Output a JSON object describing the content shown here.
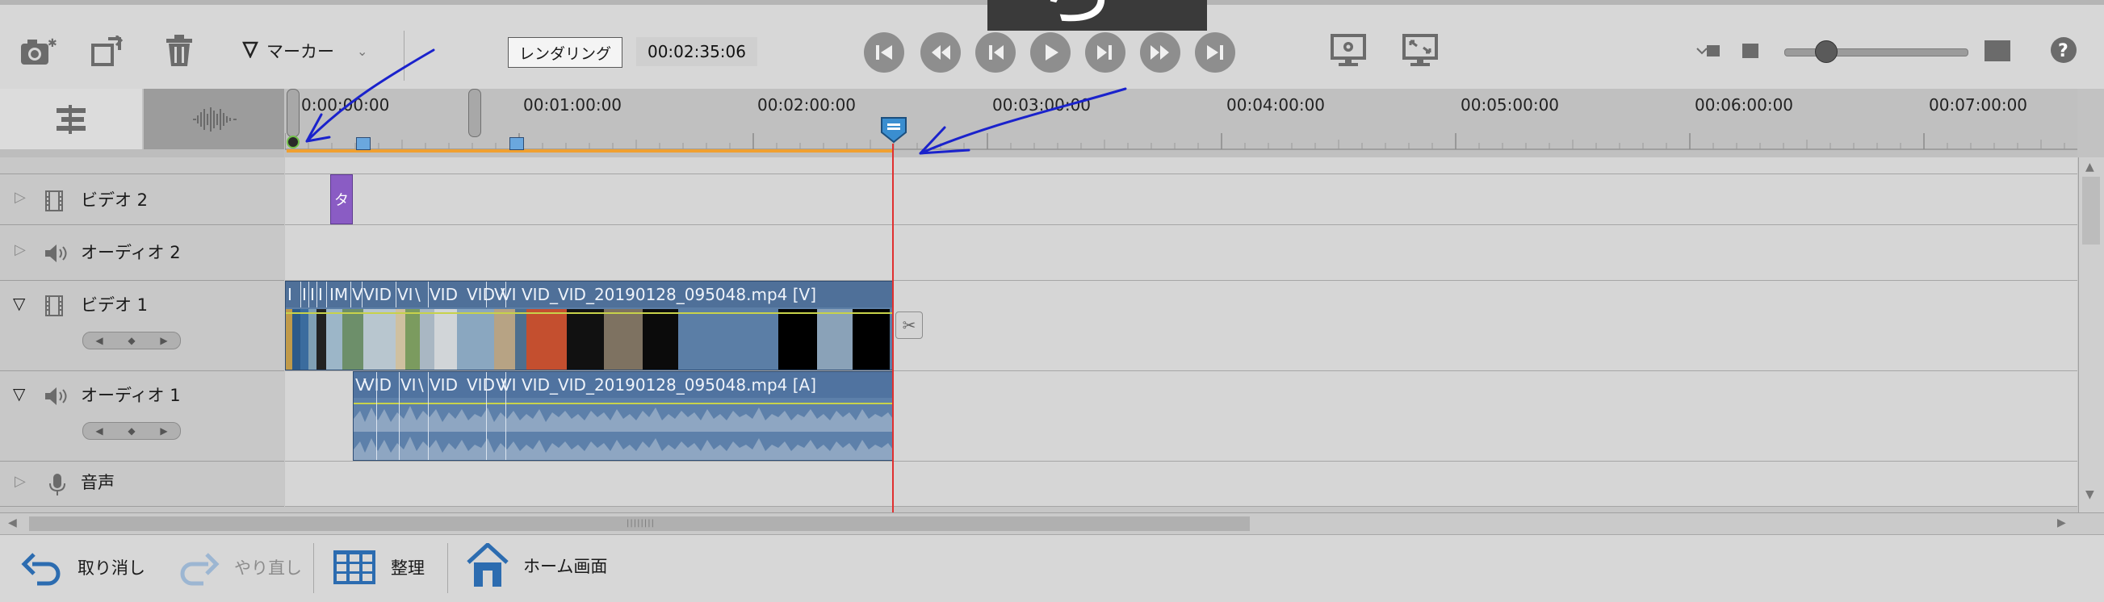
{
  "toolbar": {
    "marker_label": "マーカー",
    "render_label": "レンダリング",
    "timecode": "00:02:35:06",
    "overlay_char": "ら",
    "icons": [
      "camera-icon",
      "snapshot-icon",
      "trash-icon",
      "marker-triangle-icon",
      "chevron-down-icon",
      "goto-start-icon",
      "step-back-icon",
      "rewind-icon",
      "play-icon",
      "forward-icon",
      "step-forward-icon",
      "goto-end-icon",
      "monitor-settings-icon",
      "fullscreen-icon",
      "small-view-icon",
      "large-view-icon",
      "help-icon"
    ]
  },
  "ruler": {
    "timecodes": [
      "0:00:00:00",
      "00:01:00:00",
      "00:02:00:00",
      "00:03:00:00",
      "00:04:00:00",
      "00:05:00:00",
      "00:06:00:00",
      "00:07:00:00"
    ]
  },
  "tracks": {
    "video2": {
      "label": "ビデオ 2",
      "clip_label": "タ"
    },
    "audio2": {
      "label": "オーディオ 2"
    },
    "video1": {
      "label": "ビデオ 1",
      "clip_label": "VID_VID_20190128_095048.mp4 [V]",
      "small_labels": [
        "I",
        "I",
        "I",
        "I",
        "IM",
        "V",
        "VID",
        "VI",
        "\\",
        "VID",
        "VID",
        "V",
        "VI"
      ]
    },
    "audio1": {
      "label": "オーディオ 1",
      "clip_label": "VID_VID_20190128_095048.mp4 [A]",
      "small_labels": [
        "V",
        "VID",
        "VI",
        "\\",
        "VID",
        "VID",
        "V",
        "VI"
      ]
    },
    "voice": {
      "label": "音声"
    }
  },
  "bottom": {
    "undo": "取り消し",
    "redo": "やり直し",
    "organize": "整理",
    "home": "ホーム画面"
  },
  "colors": {
    "toolbar_bg": "#d7d7d7",
    "clip": "#5b7ea6",
    "playhead": "#e03030",
    "work_area": "#f0a030",
    "annotation": "#1a22cc",
    "title_clip": "#8a5cc4"
  }
}
